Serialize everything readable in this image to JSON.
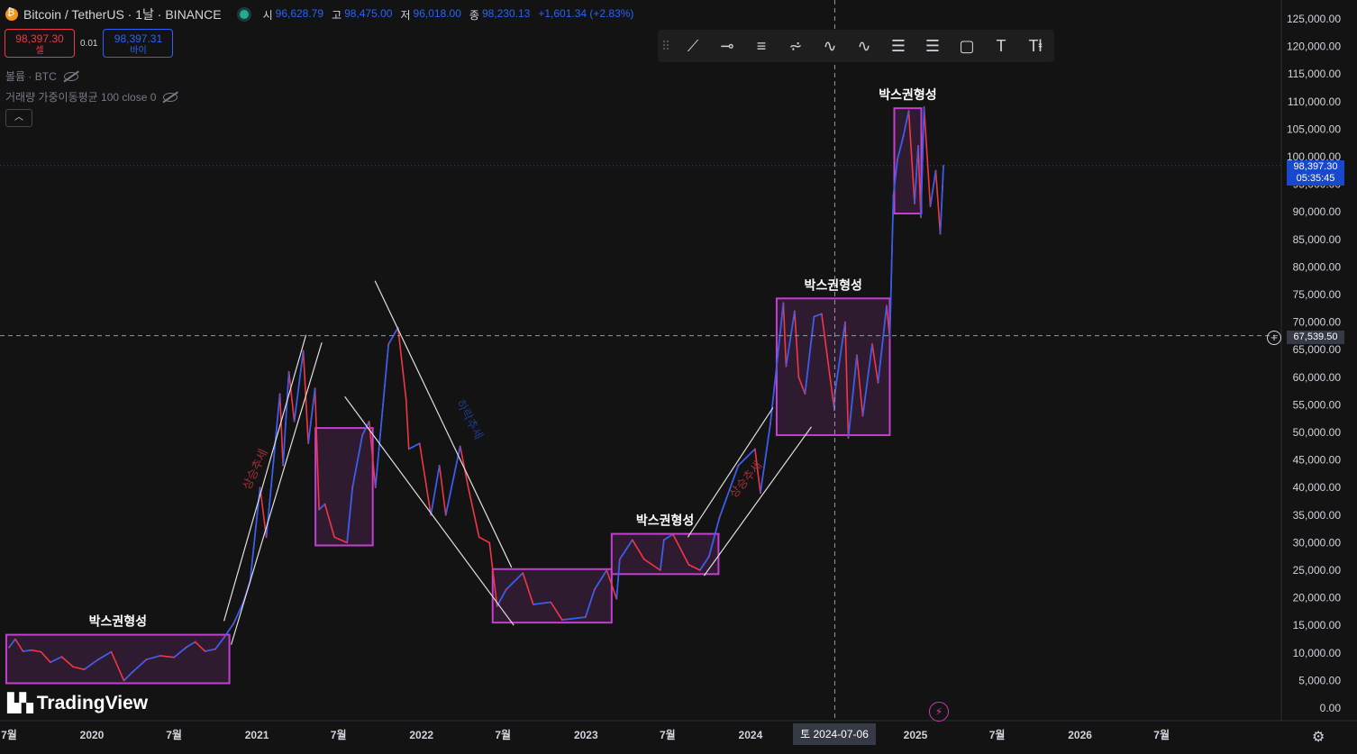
{
  "header": {
    "symbol": "Bitcoin / TetherUS · 1날 · BINANCE",
    "open_label": "시",
    "open": "96,628.79",
    "high_label": "고",
    "high": "98,475.00",
    "low_label": "저",
    "low": "96,018.00",
    "close_label": "종",
    "close": "98,230.13",
    "change": "+1,601.34 (+2.83%)"
  },
  "trade": {
    "sell_price": "98,397.30",
    "sell_label": "셀",
    "spread": "0.01",
    "buy_price": "98,397.31",
    "buy_label": "바이"
  },
  "indicators": {
    "volume": "볼륨 · BTC",
    "vwma": "거래량 가중이동평균 100 close 0"
  },
  "toolbar": {
    "icons": [
      "trend-line-icon",
      "horizontal-ray-icon",
      "parallel-channel-icon",
      "pitchfork-icon",
      "elliott-wave-12345-icon",
      "abcd-pattern-icon",
      "fib-retracement-icon",
      "fib-extension-icon",
      "rectangle-icon",
      "text-icon",
      "text-anchor-icon"
    ],
    "glyphs": [
      "⟋",
      "⊸",
      "≡",
      "⩫",
      "∿",
      "∿",
      "☰",
      "☰",
      "▢",
      "T",
      "Tⱡ"
    ]
  },
  "logo": "TradingView",
  "current_price": {
    "price": "98,397.30",
    "countdown": "05:35:45"
  },
  "crosshair": {
    "price": "67,539.50",
    "date": "토 2024-07-06"
  },
  "colors": {
    "background": "#131313",
    "up": "#2962ff",
    "down": "#f23645",
    "box": "#c33fd1",
    "box_fill": "#3a1f3a",
    "trendline": "#e0e0e0",
    "current_price": "#1848cc",
    "annotation_red": "#a0303a",
    "annotation_blue": "#1e3a8a"
  },
  "chart_data": {
    "type": "line",
    "title": "Bitcoin / TetherUS · 1날 · BINANCE",
    "xlabel": "",
    "ylabel": "",
    "ylim": [
      0,
      125000
    ],
    "yticks": [
      "0.00",
      "5,000.00",
      "10,000.00",
      "15,000.00",
      "20,000.00",
      "25,000.00",
      "30,000.00",
      "35,000.00",
      "40,000.00",
      "45,000.00",
      "50,000.00",
      "55,000.00",
      "60,000.00",
      "65,000.00",
      "70,000.00",
      "75,000.00",
      "80,000.00",
      "85,000.00",
      "90,000.00",
      "95,000.00",
      "100,000.00",
      "105,000.00",
      "110,000.00",
      "115,000.00",
      "120,000.00",
      "125,000.00"
    ],
    "xticks": [
      {
        "label": "7월",
        "date": "2019-07-01"
      },
      {
        "label": "2020",
        "date": "2020-01-01"
      },
      {
        "label": "7월",
        "date": "2020-07-01"
      },
      {
        "label": "2021",
        "date": "2021-01-01"
      },
      {
        "label": "7월",
        "date": "2021-07-01"
      },
      {
        "label": "2022",
        "date": "2022-01-01"
      },
      {
        "label": "7월",
        "date": "2022-07-01"
      },
      {
        "label": "2023",
        "date": "2023-01-01"
      },
      {
        "label": "7월",
        "date": "2023-07-01"
      },
      {
        "label": "2024",
        "date": "2024-01-01"
      },
      {
        "label": "7월",
        "date": "2024-07-01"
      },
      {
        "label": "2025",
        "date": "2025-01-01"
      },
      {
        "label": "7월",
        "date": "2025-07-01"
      },
      {
        "label": "2026",
        "date": "2026-01-01"
      },
      {
        "label": "7월",
        "date": "2026-07-01"
      }
    ],
    "series": [
      {
        "points": [
          [
            "2019-07-01",
            11000
          ],
          [
            "2019-07-15",
            12500
          ],
          [
            "2019-08-01",
            10300
          ],
          [
            "2019-08-20",
            10500
          ],
          [
            "2019-09-10",
            10200
          ],
          [
            "2019-10-01",
            8300
          ],
          [
            "2019-10-26",
            9300
          ],
          [
            "2019-11-20",
            7500
          ],
          [
            "2019-12-15",
            7000
          ],
          [
            "2020-01-15",
            8800
          ],
          [
            "2020-02-13",
            10200
          ],
          [
            "2020-03-12",
            5000
          ],
          [
            "2020-04-01",
            6600
          ],
          [
            "2020-05-01",
            8800
          ],
          [
            "2020-06-01",
            9500
          ],
          [
            "2020-07-01",
            9200
          ],
          [
            "2020-07-28",
            11000
          ],
          [
            "2020-08-17",
            12000
          ],
          [
            "2020-09-08",
            10300
          ],
          [
            "2020-10-01",
            10700
          ],
          [
            "2020-10-21",
            12900
          ],
          [
            "2020-11-10",
            15300
          ],
          [
            "2020-12-01",
            19000
          ],
          [
            "2020-12-17",
            23000
          ],
          [
            "2021-01-08",
            40000
          ],
          [
            "2021-01-22",
            31000
          ],
          [
            "2021-02-21",
            57000
          ],
          [
            "2021-02-28",
            44000
          ],
          [
            "2021-03-13",
            61000
          ],
          [
            "2021-03-25",
            52000
          ],
          [
            "2021-04-14",
            64800
          ],
          [
            "2021-04-25",
            48000
          ],
          [
            "2021-05-10",
            58000
          ],
          [
            "2021-05-19",
            36000
          ],
          [
            "2021-06-01",
            37000
          ],
          [
            "2021-06-22",
            31000
          ],
          [
            "2021-07-20",
            30000
          ],
          [
            "2021-08-01",
            40000
          ],
          [
            "2021-08-23",
            49500
          ],
          [
            "2021-09-07",
            52000
          ],
          [
            "2021-09-21",
            40000
          ],
          [
            "2021-10-20",
            66000
          ],
          [
            "2021-11-10",
            69000
          ],
          [
            "2021-11-28",
            56000
          ],
          [
            "2021-12-04",
            47000
          ],
          [
            "2021-12-28",
            48000
          ],
          [
            "2022-01-22",
            35000
          ],
          [
            "2022-02-10",
            44000
          ],
          [
            "2022-02-24",
            35000
          ],
          [
            "2022-03-28",
            47500
          ],
          [
            "2022-04-15",
            40000
          ],
          [
            "2022-05-09",
            31000
          ],
          [
            "2022-06-01",
            30000
          ],
          [
            "2022-06-18",
            18500
          ],
          [
            "2022-07-08",
            21500
          ],
          [
            "2022-08-14",
            24500
          ],
          [
            "2022-09-06",
            18800
          ],
          [
            "2022-10-15",
            19200
          ],
          [
            "2022-11-09",
            16000
          ],
          [
            "2022-12-31",
            16500
          ],
          [
            "2023-01-20",
            21500
          ],
          [
            "2023-02-16",
            25000
          ],
          [
            "2023-03-10",
            19800
          ],
          [
            "2023-03-17",
            27000
          ],
          [
            "2023-04-14",
            30500
          ],
          [
            "2023-05-10",
            27000
          ],
          [
            "2023-06-15",
            25000
          ],
          [
            "2023-06-23",
            30500
          ],
          [
            "2023-07-13",
            31500
          ],
          [
            "2023-08-17",
            26000
          ],
          [
            "2023-09-11",
            25000
          ],
          [
            "2023-10-01",
            27500
          ],
          [
            "2023-10-24",
            34500
          ],
          [
            "2023-12-05",
            44000
          ],
          [
            "2024-01-11",
            47000
          ],
          [
            "2024-01-23",
            39000
          ],
          [
            "2024-02-14",
            51500
          ],
          [
            "2024-02-28",
            62000
          ],
          [
            "2024-03-14",
            73500
          ],
          [
            "2024-03-20",
            62000
          ],
          [
            "2024-04-08",
            72000
          ],
          [
            "2024-04-17",
            60000
          ],
          [
            "2024-05-01",
            57000
          ],
          [
            "2024-05-21",
            71000
          ],
          [
            "2024-06-07",
            71500
          ],
          [
            "2024-07-05",
            54000
          ],
          [
            "2024-07-06",
            57000
          ],
          [
            "2024-07-29",
            70000
          ],
          [
            "2024-08-05",
            49000
          ],
          [
            "2024-08-24",
            64000
          ],
          [
            "2024-09-06",
            53000
          ],
          [
            "2024-09-27",
            66000
          ],
          [
            "2024-10-10",
            59000
          ],
          [
            "2024-10-29",
            73000
          ],
          [
            "2024-11-05",
            67000
          ],
          [
            "2024-11-13",
            93000
          ],
          [
            "2024-11-22",
            99500
          ],
          [
            "2024-12-05",
            103700
          ],
          [
            "2024-12-17",
            108300
          ],
          [
            "2024-12-30",
            91500
          ],
          [
            "2025-01-07",
            102000
          ],
          [
            "2025-01-13",
            89000
          ],
          [
            "2025-01-20",
            109000
          ],
          [
            "2025-02-03",
            91000
          ],
          [
            "2025-02-15",
            97500
          ],
          [
            "2025-02-25",
            86000
          ],
          [
            "2025-03-02",
            94500
          ],
          [
            "2025-03-04",
            98397
          ]
        ]
      }
    ],
    "annotations": {
      "boxes": [
        {
          "label": "박스권형성",
          "x0": "2019-06-25",
          "x1": "2020-11-01",
          "y0": 4500,
          "y1": 13300
        },
        {
          "label": "",
          "x0": "2021-05-11",
          "x1": "2021-09-15",
          "y0": 29500,
          "y1": 50800
        },
        {
          "label": "",
          "x0": "2022-06-08",
          "x1": "2023-02-27",
          "y0": 15500,
          "y1": 25200
        },
        {
          "label": "박스권형성",
          "x0": "2023-02-27",
          "x1": "2023-10-22",
          "y0": 24300,
          "y1": 31600
        },
        {
          "label": "박스권형성",
          "x0": "2024-02-28",
          "x1": "2024-11-05",
          "y0": 49500,
          "y1": 74300
        },
        {
          "label": "박스권형성",
          "x0": "2024-11-15",
          "x1": "2025-01-14",
          "y0": 89700,
          "y1": 108800
        }
      ],
      "trend_lines": [
        {
          "start": [
            "2020-10-20",
            15800
          ],
          "end": [
            "2021-04-20",
            67700
          ]
        },
        {
          "start": [
            "2020-11-05",
            11500
          ],
          "end": [
            "2021-05-25",
            66300
          ]
        },
        {
          "start": [
            "2021-09-20",
            77500
          ],
          "end": [
            "2022-07-20",
            25500
          ]
        },
        {
          "start": [
            "2021-07-15",
            56500
          ],
          "end": [
            "2022-07-25",
            15000
          ]
        },
        {
          "start": [
            "2023-08-15",
            31000
          ],
          "end": [
            "2024-02-20",
            54500
          ]
        },
        {
          "start": [
            "2023-09-20",
            24000
          ],
          "end": [
            "2024-05-15",
            51000
          ]
        }
      ],
      "labels": [
        {
          "text": "상승추세",
          "color": "red",
          "at": [
            "2021-01-05",
            43000
          ],
          "rotation": -65
        },
        {
          "text": "하락추세",
          "color": "blue",
          "at": [
            "2022-04-10",
            52000
          ],
          "rotation": 62
        },
        {
          "text": "상승추세",
          "color": "red",
          "at": [
            "2023-12-28",
            41000
          ],
          "rotation": -50
        }
      ]
    },
    "grid": false,
    "legend": "none"
  }
}
